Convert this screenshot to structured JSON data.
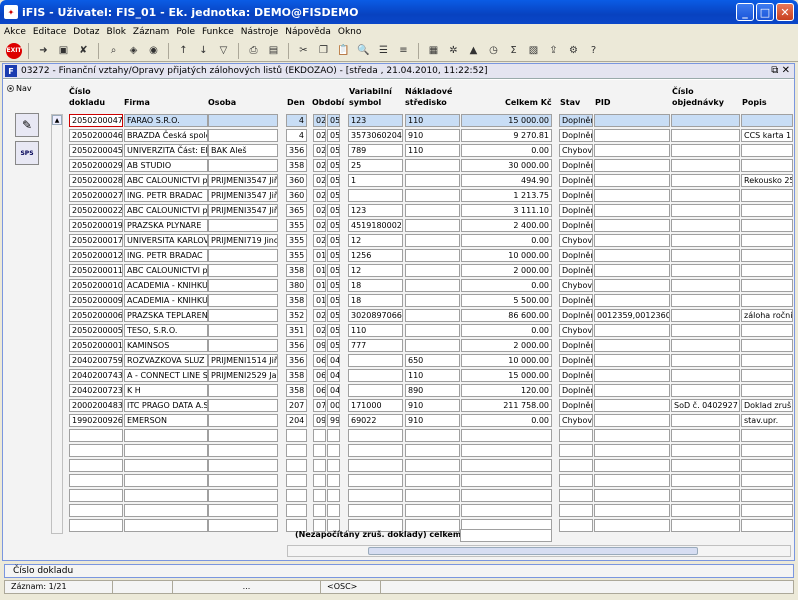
{
  "app": {
    "title": "iFIS - Uživatel: FIS_01 - Ek. jednotka: DEMO@FISDEMO"
  },
  "menu": [
    "Akce",
    "Editace",
    "Dotaz",
    "Blok",
    "Záznam",
    "Pole",
    "Funkce",
    "Nástroje",
    "Nápověda",
    "Okno"
  ],
  "form": {
    "title": "03272 - Finanční vztahy/Opravy přijatých zálohových listů (EKDOZAO) - [středa , 21.04.2010, 11:22:52]"
  },
  "nav": {
    "label": "Nav"
  },
  "side": {
    "sps_label": "SPS"
  },
  "headers": {
    "doklad": [
      "Číslo",
      "dokladu"
    ],
    "firma": "Firma",
    "osoba": "Osoba",
    "den": "Den",
    "obdobi": "Období",
    "varsym": [
      "Variabilní",
      "symbol"
    ],
    "nakl": [
      "Nákladové",
      "středisko"
    ],
    "celkem": "Celkem Kč",
    "stav": "Stav",
    "pid": "PID",
    "objed": [
      "Číslo",
      "objednávky"
    ],
    "popis": "Popis"
  },
  "rows": [
    {
      "doklad": "2050200047",
      "firma": "FARAO S.R.O.",
      "osoba": "",
      "den": "4",
      "m": "02",
      "y": "05",
      "vs": "123",
      "ns": "110",
      "celkem": "15 000.00",
      "stav": "Doplněn",
      "pid": "",
      "obj": "",
      "popis": ""
    },
    {
      "doklad": "2050200046",
      "firma": "BRAZDA Česká spole",
      "osoba": "",
      "den": "4",
      "m": "02",
      "y": "05",
      "vs": "3573060204",
      "ns": "910",
      "celkem": "9 270.81",
      "stav": "Doplněn",
      "pid": "",
      "obj": "",
      "popis": "CCS karta 1"
    },
    {
      "doklad": "2050200045",
      "firma": "UNIVERZITA Část: Ek",
      "osoba": "BAK Aleš",
      "den": "356",
      "m": "02",
      "y": "05",
      "vs": "789",
      "ns": "110",
      "celkem": "0.00",
      "stav": "Chybový",
      "pid": "",
      "obj": "",
      "popis": ""
    },
    {
      "doklad": "2050200029",
      "firma": "AB STUDIO",
      "osoba": "",
      "den": "358",
      "m": "02",
      "y": "05",
      "vs": "25",
      "ns": "",
      "celkem": "30 000.00",
      "stav": "Doplněn",
      "pid": "",
      "obj": "",
      "popis": ""
    },
    {
      "doklad": "2050200028",
      "firma": "ABC CALOUNICTVI pi",
      "osoba": "PRIJMENI3547 Jiří",
      "den": "360",
      "m": "02",
      "y": "05",
      "vs": "1",
      "ns": "",
      "celkem": "494.90",
      "stav": "Doplněn",
      "pid": "",
      "obj": "",
      "popis": "Rekousko 25"
    },
    {
      "doklad": "2050200027",
      "firma": "ING. PETR BRADAC",
      "osoba": "PRIJMENI3547 Jiří",
      "den": "360",
      "m": "02",
      "y": "05",
      "vs": "",
      "ns": "",
      "celkem": "1 213.75",
      "stav": "Doplněn",
      "pid": "",
      "obj": "",
      "popis": ""
    },
    {
      "doklad": "2050200022",
      "firma": "ABC CALOUNICTVI pi",
      "osoba": "PRIJMENI3547 Jiří",
      "den": "365",
      "m": "02",
      "y": "05",
      "vs": "123",
      "ns": "",
      "celkem": "3 111.10",
      "stav": "Doplněn",
      "pid": "",
      "obj": "",
      "popis": ""
    },
    {
      "doklad": "2050200019",
      "firma": "PRAZSKA PLYNARE",
      "osoba": "",
      "den": "355",
      "m": "02",
      "y": "05",
      "vs": "4519180002",
      "ns": "",
      "celkem": "2 400.00",
      "stav": "Doplněn",
      "pid": "",
      "obj": "",
      "popis": ""
    },
    {
      "doklad": "2050200017",
      "firma": "UNIVERSITA KARLOV",
      "osoba": "PRIJMENI719 Jindř",
      "den": "355",
      "m": "02",
      "y": "05",
      "vs": "12",
      "ns": "",
      "celkem": "0.00",
      "stav": "Chybový",
      "pid": "",
      "obj": "",
      "popis": ""
    },
    {
      "doklad": "2050200012",
      "firma": "ING. PETR BRADAC",
      "osoba": "",
      "den": "355",
      "m": "01",
      "y": "05",
      "vs": "1256",
      "ns": "",
      "celkem": "10 000.00",
      "stav": "Doplněn",
      "pid": "",
      "obj": "",
      "popis": ""
    },
    {
      "doklad": "2050200011",
      "firma": "ABC CALOUNICTVI pi",
      "osoba": "",
      "den": "358",
      "m": "01",
      "y": "05",
      "vs": "12",
      "ns": "",
      "celkem": "2 000.00",
      "stav": "Doplněn",
      "pid": "",
      "obj": "",
      "popis": ""
    },
    {
      "doklad": "2050200010",
      "firma": "ACADEMIA - KNIHKUI",
      "osoba": "",
      "den": "380",
      "m": "01",
      "y": "05",
      "vs": "18",
      "ns": "",
      "celkem": "0.00",
      "stav": "Chybový",
      "pid": "",
      "obj": "",
      "popis": ""
    },
    {
      "doklad": "2050200009",
      "firma": "ACADEMIA - KNIHKUI",
      "osoba": "",
      "den": "358",
      "m": "01",
      "y": "05",
      "vs": "18",
      "ns": "",
      "celkem": "5 500.00",
      "stav": "Doplněn",
      "pid": "",
      "obj": "",
      "popis": ""
    },
    {
      "doklad": "2050200006",
      "firma": "PRAZSKA TEPLAREN",
      "osoba": "",
      "den": "352",
      "m": "02",
      "y": "05",
      "vs": "3020897066",
      "ns": "",
      "celkem": "86 600.00",
      "stav": "Doplněn",
      "pid": "0012359,0012360",
      "obj": "",
      "popis": "záloha roční"
    },
    {
      "doklad": "2050200005",
      "firma": "TESO, S.R.O.",
      "osoba": "",
      "den": "351",
      "m": "02",
      "y": "05",
      "vs": "110",
      "ns": "",
      "celkem": "0.00",
      "stav": "Chybový",
      "pid": "",
      "obj": "",
      "popis": ""
    },
    {
      "doklad": "2050200001",
      "firma": "KAMINSOS",
      "osoba": "",
      "den": "356",
      "m": "09",
      "y": "05",
      "vs": "777",
      "ns": "",
      "celkem": "2 000.00",
      "stav": "Doplněn",
      "pid": "",
      "obj": "",
      "popis": ""
    },
    {
      "doklad": "2040200759",
      "firma": "ROZVAZKOVA SLUZ",
      "osoba": "PRIJMENI1514 Jiří",
      "den": "356",
      "m": "06",
      "y": "04",
      "vs": "",
      "ns": "650",
      "celkem": "10 000.00",
      "stav": "Doplněn",
      "pid": "",
      "obj": "",
      "popis": ""
    },
    {
      "doklad": "2040200743",
      "firma": "A - CONNECT LINE SF",
      "osoba": "PRIJMENI2529 Jan",
      "den": "358",
      "m": "06",
      "y": "04",
      "vs": "",
      "ns": "110",
      "celkem": "15 000.00",
      "stav": "Doplněn",
      "pid": "",
      "obj": "",
      "popis": ""
    },
    {
      "doklad": "2040200723",
      "firma": "K H",
      "osoba": "",
      "den": "358",
      "m": "06",
      "y": "04",
      "vs": "",
      "ns": "890",
      "celkem": "120.00",
      "stav": "Doplněn",
      "pid": "",
      "obj": "",
      "popis": ""
    },
    {
      "doklad": "2000200483",
      "firma": "ITC PRAGO DATA A.S",
      "osoba": "",
      "den": "207",
      "m": "07",
      "y": "00",
      "vs": "171000",
      "ns": "910",
      "celkem": "211 758.00",
      "stav": "Doplněn",
      "pid": "",
      "obj": "SoD č. 0402927",
      "popis": "Doklad zruš"
    },
    {
      "doklad": "1990200926",
      "firma": "EMERSON",
      "osoba": "",
      "den": "204",
      "m": "09",
      "y": "99",
      "vs": "69022",
      "ns": "910",
      "celkem": "0.00",
      "stav": "Chybový",
      "pid": "",
      "obj": "",
      "popis": "stav.upr."
    }
  ],
  "empty_rows": 7,
  "footer": {
    "label": "(Nezapočítány zruš. doklady) celkem"
  },
  "status": {
    "hint": "Číslo dokladu",
    "record": "Záznam: 1/21",
    "dots": "...",
    "osc": "<OSC>"
  },
  "colors": {
    "titlebar": "#0842c0",
    "selected_row": "#c8ddf5",
    "focus_border": "#cc0000"
  }
}
